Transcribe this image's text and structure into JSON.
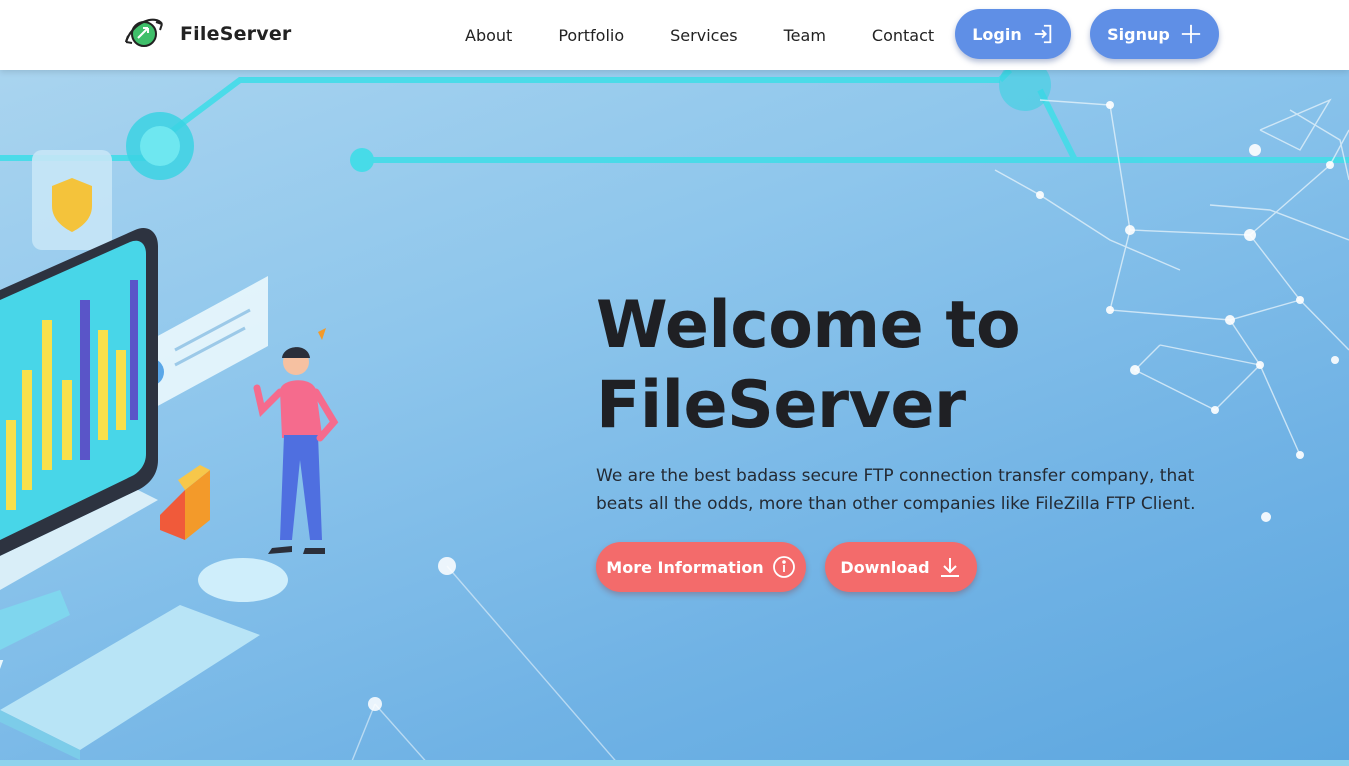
{
  "header": {
    "brand": {
      "name": "FileServer",
      "logo_icon": "globe-arrows-icon"
    },
    "nav": [
      {
        "label": "About"
      },
      {
        "label": "Portfolio"
      },
      {
        "label": "Services"
      },
      {
        "label": "Team"
      },
      {
        "label": "Contact"
      }
    ],
    "login": {
      "label": "Login",
      "icon": "sign-in-icon"
    },
    "signup": {
      "label": "Signup",
      "icon": "plus-icon"
    }
  },
  "hero": {
    "title_line1": "Welcome to",
    "title_line2": "FileServer",
    "description": "We are the best badass secure FTP connection transfer company, that beats all the odds, more than other companies like FileZilla FTP Client.",
    "buttons": {
      "more_info": {
        "label": "More Information",
        "icon": "info-circle-icon"
      },
      "download": {
        "label": "Download",
        "icon": "download-arrow-icon"
      }
    }
  },
  "colors": {
    "accent_blue": "#5f8fe6",
    "accent_red": "#f36b6b",
    "hero_bg": "#7ab8e6",
    "text_dark": "#1f2024"
  }
}
